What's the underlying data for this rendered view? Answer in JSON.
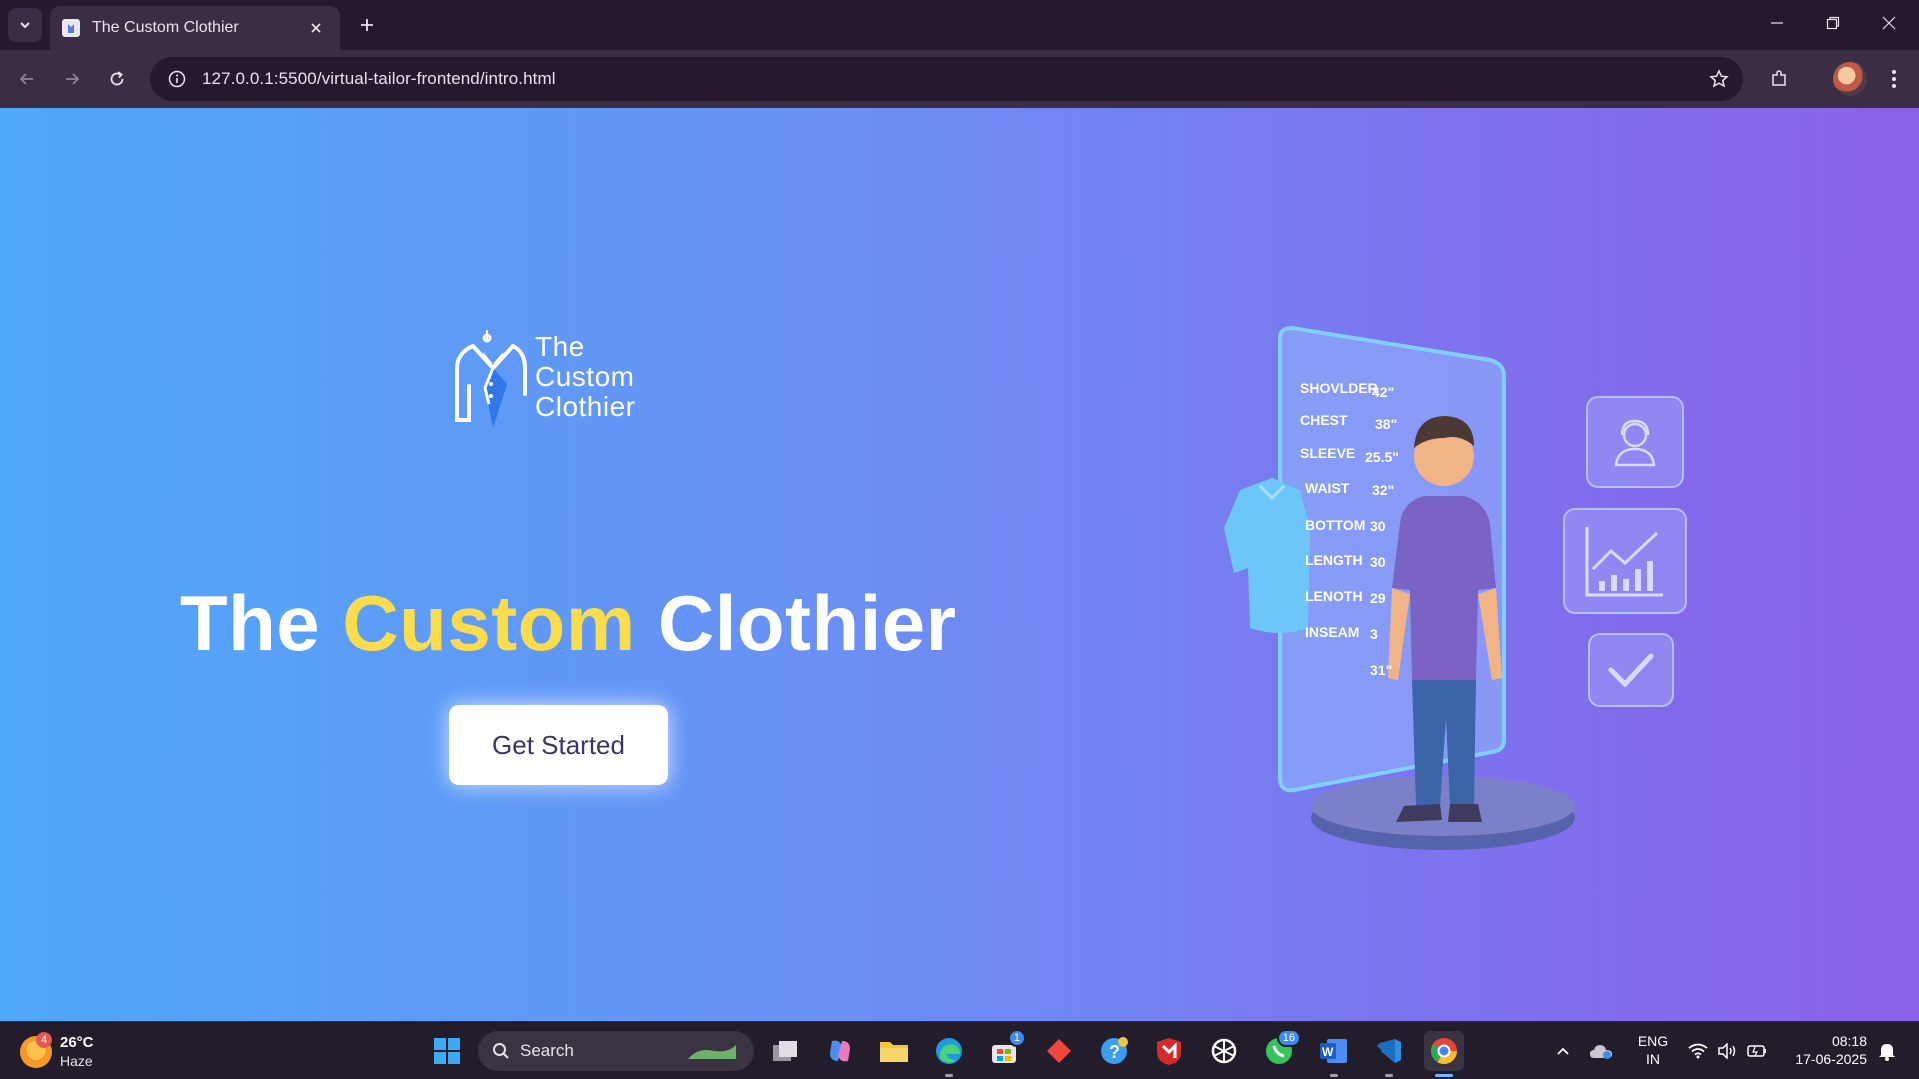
{
  "browser": {
    "tab": {
      "title": "The Custom Clothier"
    },
    "address_bar": {
      "url": "127.0.0.1:5500/virtual-tailor-frontend/intro.html"
    }
  },
  "page": {
    "logo": {
      "line1": "The",
      "line2": "Custom",
      "line3": "Clothier"
    },
    "hero": {
      "part1": "The",
      "accent": "Custom",
      "part2": "Clothier"
    },
    "cta_label": "Get Started",
    "illustration": {
      "measurements": [
        {
          "label": "SHOVLDER",
          "value": "42\""
        },
        {
          "label": "CHEST",
          "value": "38\""
        },
        {
          "label": "SLEEVE",
          "value": "25.5\""
        },
        {
          "label": "WAIST",
          "value": "32\""
        },
        {
          "label": "BOTTOM",
          "value": "30"
        },
        {
          "label": "LENGTH",
          "value": "30"
        },
        {
          "label": "LENOTH",
          "value": "29"
        },
        {
          "label": "INSEAM",
          "value": "3"
        },
        {
          "label": "",
          "value": "31\""
        }
      ]
    }
  },
  "taskbar": {
    "weather": {
      "temp": "26°C",
      "condition": "Haze",
      "badge": "4"
    },
    "search_label": "Search",
    "badges": {
      "store": "1",
      "whatsapp": "16"
    },
    "language": {
      "line1": "ENG",
      "line2": "IN"
    },
    "clock": {
      "time": "08:18",
      "date": "17-06-2025"
    }
  },
  "colors": {
    "gradient_start": "#4fa8fb",
    "gradient_end": "#8a61e8",
    "accent": "#fbdc4d",
    "cta_text": "#3a3468"
  }
}
